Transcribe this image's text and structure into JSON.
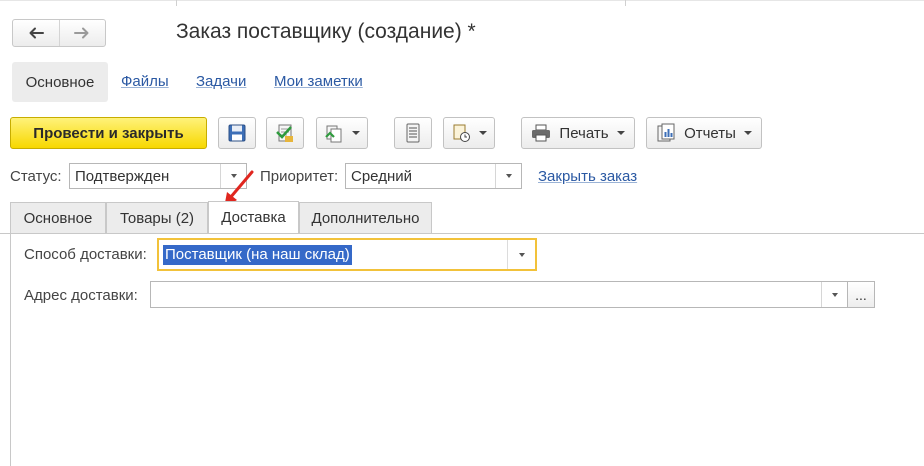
{
  "window": {
    "title": "Заказ поставщику (создание) *"
  },
  "nav": {
    "back_icon": "arrow-left-icon",
    "forward_icon": "arrow-right-icon"
  },
  "top_tabs": {
    "active": "Основное",
    "links": [
      "Файлы",
      "Задачи",
      "Мои заметки"
    ]
  },
  "toolbar": {
    "post_close_label": "Провести и закрыть",
    "save_icon": "floppy-disk-icon",
    "post_icon": "post-document-icon",
    "create_based_icon": "create-based-on-icon",
    "structure_icon": "document-structure-icon",
    "attach_icon": "files-clock-icon",
    "print_label": "Печать",
    "reports_label": "Отчеты",
    "accent_color": "#f7d800"
  },
  "header": {
    "status_label": "Статус:",
    "status_value": "Подтвержден",
    "priority_label": "Приоритет:",
    "priority_value": "Средний",
    "close_order_link": "Закрыть заказ"
  },
  "tabs": [
    {
      "label": "Основное",
      "active": false
    },
    {
      "label": "Товары (2)",
      "active": false
    },
    {
      "label": "Доставка",
      "active": true
    },
    {
      "label": "Дополнительно",
      "active": false
    }
  ],
  "delivery": {
    "method_label": "Способ доставки:",
    "method_value": "Поставщик (на наш склад)",
    "address_label": "Адрес доставки:",
    "address_value": "",
    "ellipsis_label": "..."
  }
}
